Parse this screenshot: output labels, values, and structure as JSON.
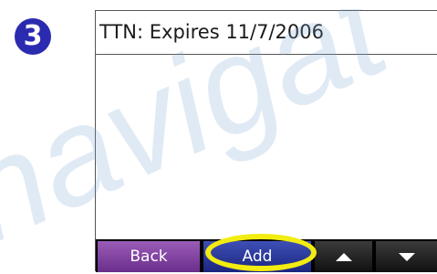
{
  "step": {
    "number": "3",
    "badge_color": "#2b2bb0"
  },
  "watermark": {
    "text": "navigat",
    "color": "#7fa6cf"
  },
  "screen": {
    "title": "TTN: Expires 11/7/2006"
  },
  "buttons": {
    "back_label": "Back",
    "add_label": "Add",
    "up_icon": "arrow-up-icon",
    "down_icon": "arrow-down-icon",
    "back_color": "#7a3d9c",
    "add_color": "#2a35a0"
  },
  "highlight": {
    "color": "#f2ec10",
    "target": "Add"
  }
}
